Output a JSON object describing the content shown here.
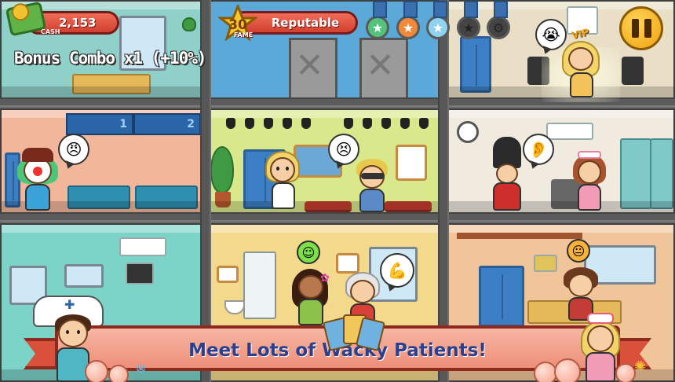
{
  "hud": {
    "cash_value": "2,153",
    "cash_label": "CASH",
    "fame_level": "30",
    "fame_label": "FAME",
    "fame_title": "Reputable",
    "bonus_combo": "Bonus Combo x1 (+10%)",
    "vip_label": "VIP"
  },
  "medals": [
    {
      "name": "star-medal-green",
      "symbol": "★",
      "color": "#53c27a"
    },
    {
      "name": "star-medal-orange",
      "symbol": "★",
      "color": "#f08a3a"
    },
    {
      "name": "star-medal-blue",
      "symbol": "★",
      "color": "#8fd3f0"
    },
    {
      "name": "star-medal-dark",
      "symbol": "★",
      "color": "#444444"
    },
    {
      "name": "gear-medal-dark",
      "symbol": "⚙",
      "color": "#444444"
    }
  ],
  "rooms": {
    "waiting_numbers": [
      "1",
      "2"
    ]
  },
  "banner": {
    "text": "Meet Lots of Wacky Patients!"
  },
  "colors": {
    "hud_red": "#d2402f",
    "banner_text": "#2c3f8c",
    "pause_gold": "#f0a20e"
  }
}
